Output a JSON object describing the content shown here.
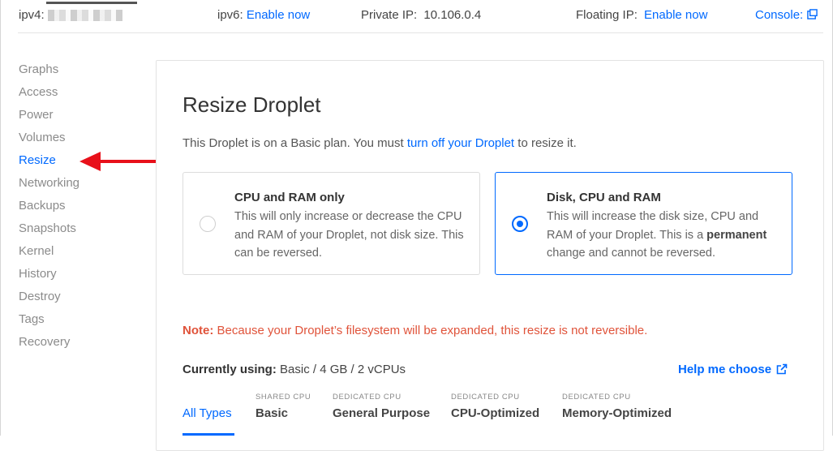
{
  "topbar": {
    "ipv4_label": "ipv4:",
    "ipv6_label": "ipv6:",
    "ipv6_link": "Enable now",
    "private_ip_label": "Private IP:",
    "private_ip_value": "10.106.0.4",
    "floating_ip_label": "Floating IP:",
    "floating_ip_link": "Enable now",
    "console_link": "Console:"
  },
  "sidebar": {
    "items": [
      {
        "label": "Graphs"
      },
      {
        "label": "Access"
      },
      {
        "label": "Power"
      },
      {
        "label": "Volumes"
      },
      {
        "label": "Resize"
      },
      {
        "label": "Networking"
      },
      {
        "label": "Backups"
      },
      {
        "label": "Snapshots"
      },
      {
        "label": "Kernel"
      },
      {
        "label": "History"
      },
      {
        "label": "Destroy"
      },
      {
        "label": "Tags"
      },
      {
        "label": "Recovery"
      }
    ],
    "active_index": 4
  },
  "main": {
    "title": "Resize Droplet",
    "subtitle_pre": "This Droplet is on a Basic plan. You must ",
    "subtitle_link": "turn off your Droplet",
    "subtitle_post": " to resize it.",
    "options": [
      {
        "title": "CPU and RAM only",
        "description": "This will only increase or decrease the CPU and RAM of your Droplet, not disk size. This can be reversed.",
        "selected": false
      },
      {
        "title": "Disk, CPU and RAM",
        "description_pre": "This will increase the disk size, CPU and RAM of your Droplet. This is a ",
        "description_bold": "permanent",
        "description_post": " change and cannot be reversed.",
        "selected": true
      }
    ],
    "note_label": "Note:",
    "note_text": " Because your Droplet’s filesystem will be expanded, this resize is not reversible.",
    "current_label": "Currently using:",
    "current_value": " Basic / 4 GB / 2 vCPUs",
    "help_link": "Help me choose",
    "type_tabs": [
      {
        "kicker": "",
        "label": "All Types",
        "active": true
      },
      {
        "kicker": "SHARED CPU",
        "label": "Basic",
        "active": false
      },
      {
        "kicker": "DEDICATED CPU",
        "label": "General Purpose",
        "active": false
      },
      {
        "kicker": "DEDICATED CPU",
        "label": "CPU-Optimized",
        "active": false
      },
      {
        "kicker": "DEDICATED CPU",
        "label": "Memory-Optimized",
        "active": false
      }
    ]
  },
  "colors": {
    "accent": "#0069ff",
    "annotation_arrow": "#e8101a",
    "note": "#e0533a"
  },
  "icons": {
    "console": "external-window-icon",
    "help": "external-link-icon",
    "annotation": "red-arrow-icon"
  }
}
